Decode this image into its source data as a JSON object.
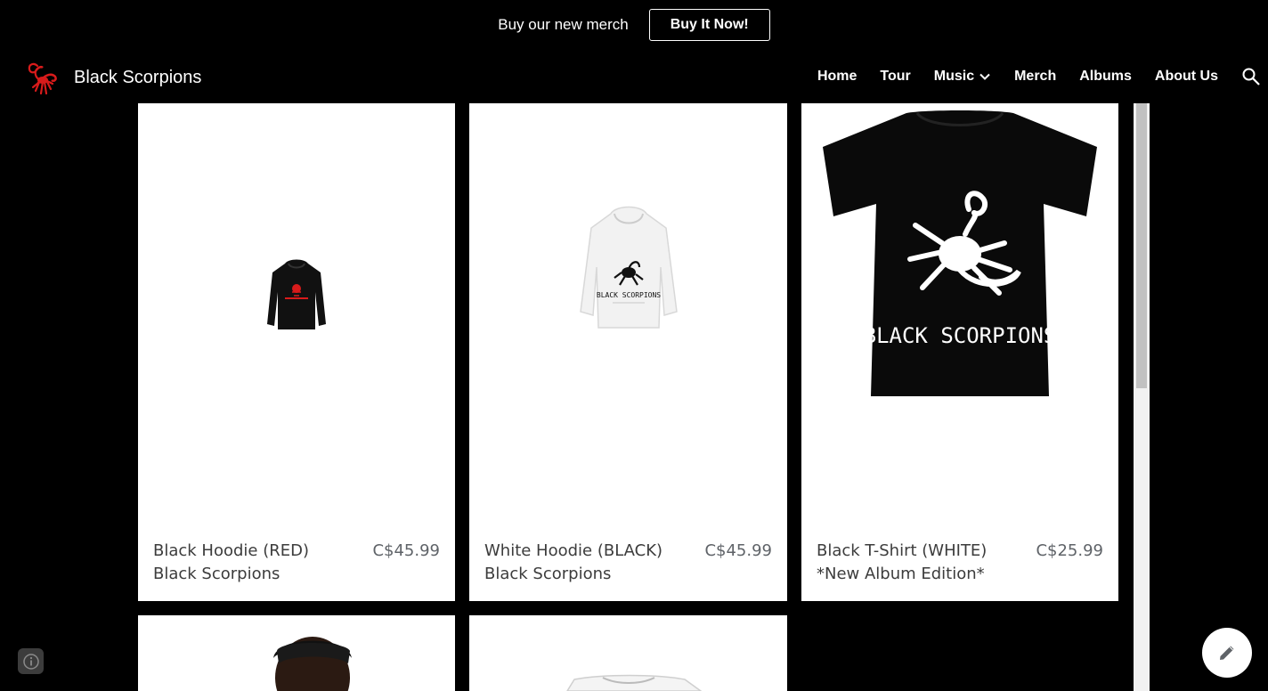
{
  "announcement": {
    "text": "Buy our new merch",
    "button_label": "Buy It Now!"
  },
  "header": {
    "site_title": "Black Scorpions",
    "logo_icon": "scorpion-logo-icon",
    "nav": [
      {
        "label": "Home"
      },
      {
        "label": "Tour"
      },
      {
        "label": "Music",
        "has_dropdown": true
      },
      {
        "label": "Merch"
      },
      {
        "label": "Albums"
      },
      {
        "label": "About Us"
      }
    ],
    "search_icon": "search-icon"
  },
  "products": [
    {
      "name_line1": "Black Hoodie (RED)",
      "name_line2": "Black Scorpions",
      "price": "C$45.99"
    },
    {
      "name_line1": "White Hoodie (BLACK)",
      "name_line2": "Black Scorpions",
      "price": "C$45.99"
    },
    {
      "name_line1": "Black T-Shirt (WHITE)",
      "name_line2": "*New Album Edition*",
      "price": "C$25.99"
    }
  ],
  "shirt_print": "BLACK SCORPIONS",
  "hoodie_print": "BLACK SCORPIONS",
  "colors": {
    "background": "#000000",
    "accent": "#e00000",
    "card": "#ffffff"
  }
}
